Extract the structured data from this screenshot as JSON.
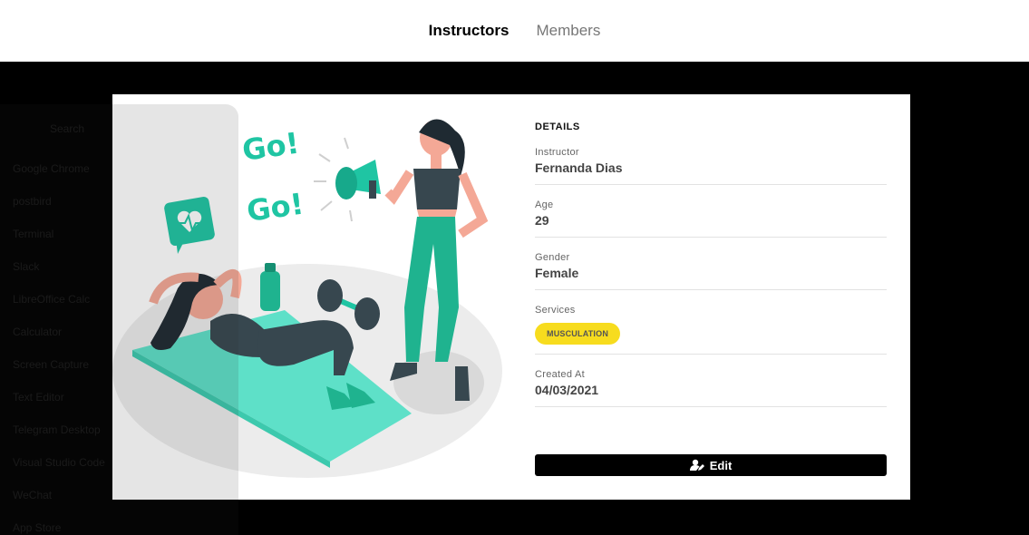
{
  "nav": {
    "tabs": [
      {
        "label": "Instructors",
        "active": true
      },
      {
        "label": "Members",
        "active": false
      }
    ]
  },
  "details": {
    "title": "DETAILS",
    "instructor_label": "Instructor",
    "instructor_value": "Fernanda Dias",
    "age_label": "Age",
    "age_value": "29",
    "gender_label": "Gender",
    "gender_value": "Female",
    "services_label": "Services",
    "services": [
      "MUSCULATION"
    ],
    "created_label": "Created At",
    "created_value": "04/03/2021",
    "edit_label": "Edit"
  },
  "illustration": {
    "go_text": "Go!"
  },
  "overlay": {
    "search_placeholder": "Search",
    "apps": [
      "Google Chrome",
      "postbird",
      "Terminal",
      "Slack",
      "LibreOffice Calc",
      "Calculator",
      "Screen Capture",
      "Text Editor",
      "Telegram Desktop",
      "Visual Studio Code",
      "WeChat",
      "App Store"
    ]
  },
  "colors": {
    "accent_teal": "#1fc5a3",
    "badge_yellow": "#f7dc1e",
    "button_black": "#000000"
  }
}
